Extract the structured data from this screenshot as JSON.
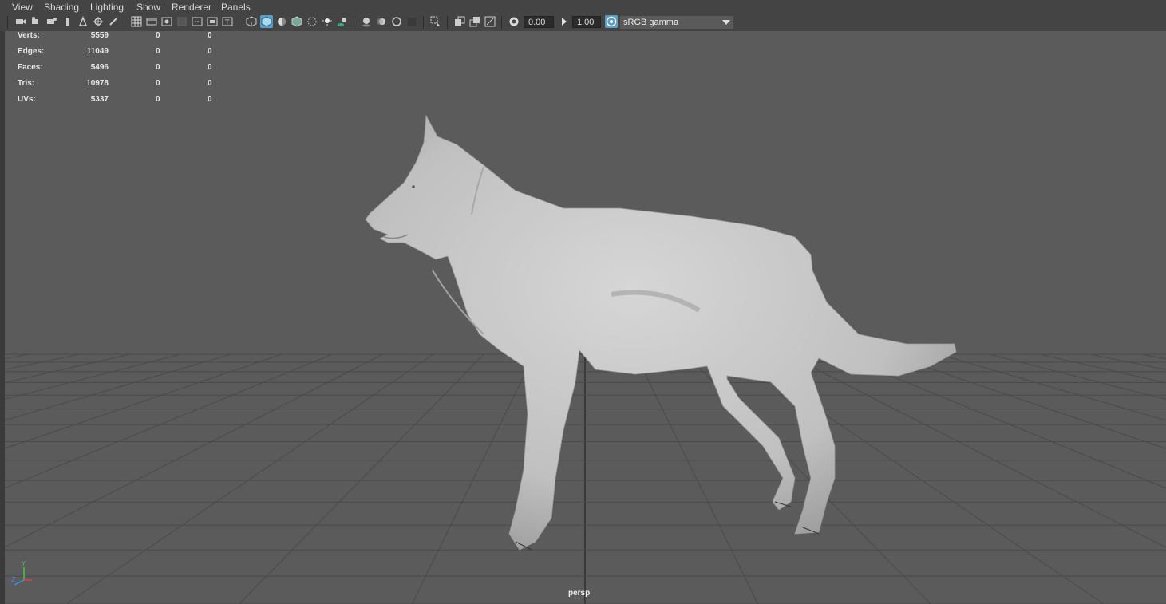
{
  "menus": [
    "View",
    "Shading",
    "Lighting",
    "Show",
    "Renderer",
    "Panels"
  ],
  "toolbar": {
    "exposure": "0.00",
    "gamma": "1.00",
    "color_space": "sRGB gamma"
  },
  "hud": {
    "rows": [
      {
        "label": "Verts:",
        "v1": "5559",
        "v2": "0",
        "v3": "0"
      },
      {
        "label": "Edges:",
        "v1": "11049",
        "v2": "0",
        "v3": "0"
      },
      {
        "label": "Faces:",
        "v1": "5496",
        "v2": "0",
        "v3": "0"
      },
      {
        "label": "Tris:",
        "v1": "10978",
        "v2": "0",
        "v3": "0"
      },
      {
        "label": "UVs:",
        "v1": "5337",
        "v2": "0",
        "v3": "0"
      }
    ]
  },
  "viewport": {
    "camera": "persp",
    "background_color": "#5b5b5b",
    "model_color": "#c9c9c9"
  },
  "axis_labels": {
    "y": "Y",
    "z": "Z"
  }
}
